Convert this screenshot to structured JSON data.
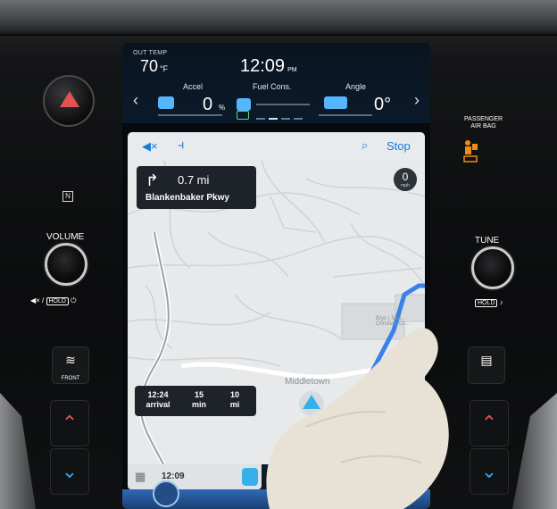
{
  "status": {
    "out_temp_label": "OUT TEMP",
    "out_temp_value": "70",
    "out_temp_unit": "°F",
    "clock": "12:09",
    "clock_ampm": "PM"
  },
  "gauges": {
    "accel_title": "Accel",
    "accel_value": "0",
    "accel_unit": "%",
    "fuel_title": "Fuel Cons.",
    "angle_title": "Angle",
    "angle_value": "0°"
  },
  "nav": {
    "stop_label": "Stop",
    "turn_distance": "0.7 mi",
    "turn_street": "Blankenbaker Pkwy",
    "speed_value": "0",
    "speed_unit": "mph",
    "town_label": "Middletown",
    "poi_label": "Bryn | Sou... Christian Ch...",
    "eta": [
      {
        "value": "12:24",
        "label": "arrival"
      },
      {
        "value": "15",
        "label": "min"
      },
      {
        "value": "10",
        "label": "mi"
      }
    ],
    "dock_time": "12:09"
  },
  "controls": {
    "volume_label": "VOLUME",
    "tune_label": "TUNE",
    "hold_label": "HOLD",
    "front_label": "FRONT",
    "airbag_label_1": "PASSENGER",
    "airbag_label_2": "AIR BAG"
  },
  "colors": {
    "accent_blue": "#1a78d8",
    "route_blue": "#3b82e8",
    "hazard_red": "#e05352",
    "airbag_orange": "#f08a1c"
  },
  "icons": [
    "hazard-icon",
    "nfc-icon",
    "mute-icon",
    "defrost-front-icon",
    "up-arrow-icon",
    "down-arrow-icon",
    "search-icon",
    "route-icon",
    "turn-right-icon",
    "car-position-icon",
    "apps-grid-icon",
    "airbag-off-icon",
    "rear-defrost-icon"
  ]
}
